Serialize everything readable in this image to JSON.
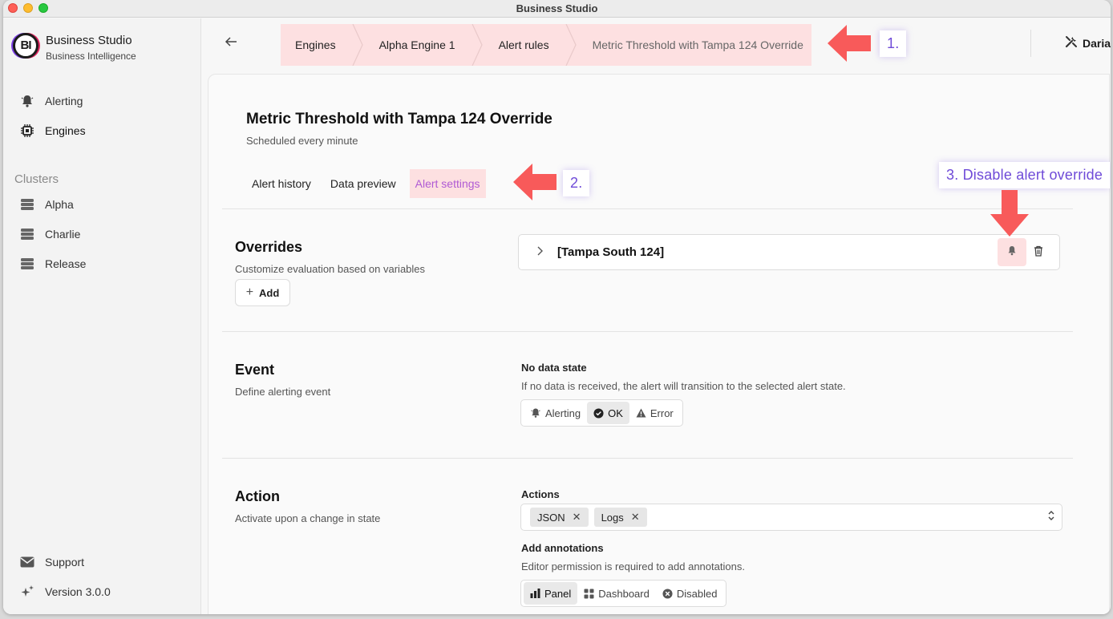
{
  "window": {
    "title": "Business Studio"
  },
  "brand": {
    "logo_text": "BI",
    "name": "Business Studio",
    "subtitle": "Business Intelligence"
  },
  "sidebar": {
    "nav": [
      {
        "label": "Alerting",
        "icon": "bell-icon"
      },
      {
        "label": "Engines",
        "icon": "chip-icon",
        "active": true
      }
    ],
    "clusters_label": "Clusters",
    "clusters": [
      {
        "label": "Alpha",
        "icon": "database-icon"
      },
      {
        "label": "Charlie",
        "icon": "database-icon"
      },
      {
        "label": "Release",
        "icon": "database-icon"
      }
    ],
    "footer": [
      {
        "label": "Support",
        "icon": "envelope-icon"
      },
      {
        "label": "Version 3.0.0",
        "icon": "sparkle-icon"
      }
    ]
  },
  "header": {
    "breadcrumbs": [
      "Engines",
      "Alpha Engine 1",
      "Alert rules",
      "Metric Threshold with Tampa 124 Override"
    ],
    "user": "Daria"
  },
  "page": {
    "title": "Metric Threshold with Tampa 124 Override",
    "subtitle": "Scheduled every minute",
    "tabs": [
      "Alert history",
      "Data preview",
      "Alert settings"
    ],
    "active_tab": "Alert settings"
  },
  "overrides": {
    "title": "Overrides",
    "description": "Customize evaluation based on variables",
    "add_label": "Add",
    "items": [
      {
        "name": "[Tampa South 124]"
      }
    ]
  },
  "event": {
    "title": "Event",
    "description": "Define alerting event",
    "no_data_label": "No data state",
    "no_data_help": "If no data is received, the alert will transition to the selected alert state.",
    "options": [
      "Alerting",
      "OK",
      "Error"
    ],
    "selected": "OK"
  },
  "action": {
    "title": "Action",
    "description": "Activate upon a change in state",
    "actions_label": "Actions",
    "actions": [
      "JSON",
      "Logs"
    ],
    "annotations_label": "Add annotations",
    "annotations_help": "Editor permission is required to add annotations.",
    "annotation_options": [
      "Panel",
      "Dashboard",
      "Disabled"
    ],
    "annotation_selected": "Panel"
  },
  "annotations": {
    "step1": "1.",
    "step2": "2.",
    "step3": "3. Disable alert override",
    "arrow_color": "#f85a5a"
  },
  "colors": {
    "highlight": "#fde0e1",
    "active_tab_text": "#b05ad4",
    "annotation_text": "#6f4bd8"
  }
}
